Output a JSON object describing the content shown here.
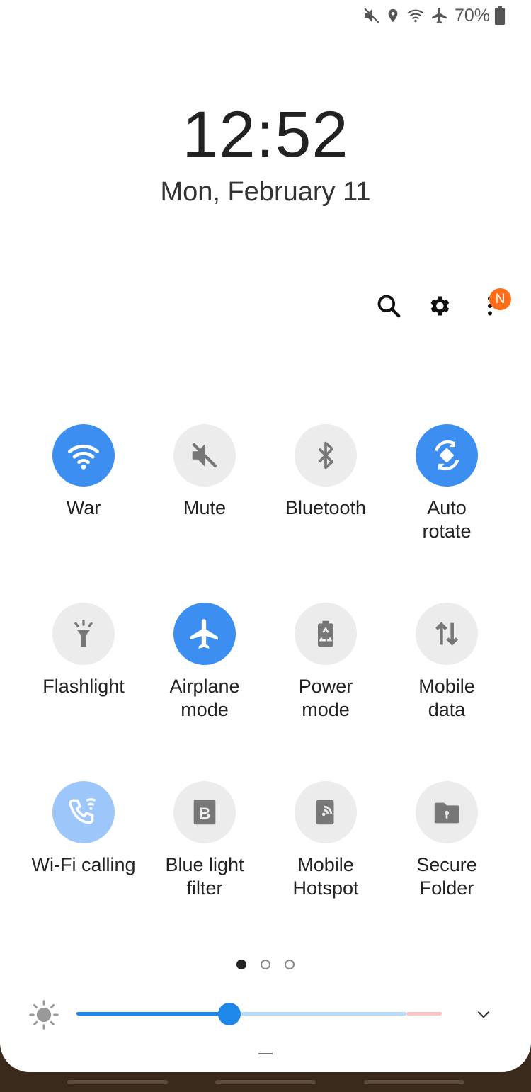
{
  "status_bar": {
    "battery_text": "70%",
    "icons": [
      "mute-icon",
      "location-icon",
      "wifi-icon",
      "airplane-icon",
      "battery-icon"
    ]
  },
  "clock": {
    "time": "12:52",
    "date": "Mon, February 11"
  },
  "actions": {
    "search_icon": "search-icon",
    "settings_icon": "gear-icon",
    "more_icon": "more-vert-icon",
    "badge": "N",
    "badge_color": "#ff6d1a"
  },
  "tiles": [
    {
      "label": "War",
      "icon": "wifi-icon",
      "state": "on"
    },
    {
      "label": "Mute",
      "icon": "mute-icon",
      "state": "off"
    },
    {
      "label": "Bluetooth",
      "icon": "bluetooth-icon",
      "state": "off"
    },
    {
      "label": "Auto\nrotate",
      "icon": "auto-rotate-icon",
      "state": "on"
    },
    {
      "label": "Flashlight",
      "icon": "flashlight-icon",
      "state": "off"
    },
    {
      "label": "Airplane\nmode",
      "icon": "airplane-icon",
      "state": "on"
    },
    {
      "label": "Power\nmode",
      "icon": "power-mode-icon",
      "state": "off"
    },
    {
      "label": "Mobile\ndata",
      "icon": "mobile-data-icon",
      "state": "off"
    },
    {
      "label": "Wi-Fi calling",
      "icon": "wifi-calling-icon",
      "state": "partial"
    },
    {
      "label": "Blue light\nfilter",
      "icon": "blue-light-filter-icon",
      "state": "off"
    },
    {
      "label": "Mobile\nHotspot",
      "icon": "hotspot-icon",
      "state": "off"
    },
    {
      "label": "Secure\nFolder",
      "icon": "secure-folder-icon",
      "state": "off"
    }
  ],
  "pagination": {
    "current": 1,
    "total": 3
  },
  "brightness": {
    "level": 0.42,
    "icon": "brightness-icon"
  },
  "colors": {
    "accent": "#3c8ff0",
    "tile_off": "#ececec",
    "tile_partial": "#9dc7fb",
    "slider": "#1e88ea"
  }
}
